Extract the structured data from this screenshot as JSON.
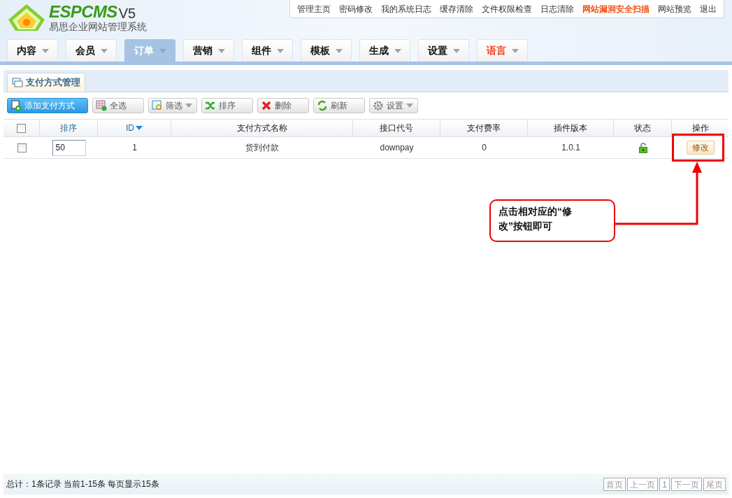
{
  "logo": {
    "brand": "ESPCMS",
    "version": "V5",
    "subtitle": "易思企业网站管理系统"
  },
  "top_links": [
    {
      "label": "管理主页",
      "kind": "normal"
    },
    {
      "label": "密码修改",
      "kind": "normal"
    },
    {
      "label": "我的系统日志",
      "kind": "normal"
    },
    {
      "label": "缓存清除",
      "kind": "normal"
    },
    {
      "label": "文件权限检查",
      "kind": "normal"
    },
    {
      "label": "日志清除",
      "kind": "normal"
    },
    {
      "label": "网站漏洞安全扫描",
      "kind": "alert"
    },
    {
      "label": "网站预览",
      "kind": "normal"
    },
    {
      "label": "退出",
      "kind": "normal"
    }
  ],
  "nav_tabs": [
    {
      "label": "内容",
      "selected": false,
      "kind": "normal"
    },
    {
      "label": "会员",
      "selected": false,
      "kind": "normal"
    },
    {
      "label": "订单",
      "selected": true,
      "kind": "normal"
    },
    {
      "label": "营销",
      "selected": false,
      "kind": "normal"
    },
    {
      "label": "组件",
      "selected": false,
      "kind": "normal"
    },
    {
      "label": "模板",
      "selected": false,
      "kind": "normal"
    },
    {
      "label": "生成",
      "selected": false,
      "kind": "normal"
    },
    {
      "label": "设置",
      "selected": false,
      "kind": "normal"
    },
    {
      "label": "语言",
      "selected": false,
      "kind": "alert"
    }
  ],
  "panel_tab": "支付方式管理",
  "toolbar": [
    {
      "label": "添加支付方式",
      "kind": "primary",
      "dropdown": false
    },
    {
      "label": "全选",
      "kind": "normal",
      "dropdown": false
    },
    {
      "label": "筛选",
      "kind": "normal",
      "dropdown": true
    },
    {
      "label": "排序",
      "kind": "normal",
      "dropdown": false
    },
    {
      "label": "删除",
      "kind": "normal",
      "dropdown": false
    },
    {
      "label": "刷新",
      "kind": "normal",
      "dropdown": false
    },
    {
      "label": "设置",
      "kind": "normal",
      "dropdown": true
    }
  ],
  "table": {
    "header_checkbox_checked": false,
    "columns": [
      "排序",
      "ID",
      "支付方式名称",
      "接口代号",
      "支付费率",
      "插件版本",
      "状态",
      "操作"
    ],
    "rows": [
      {
        "checked": false,
        "sort": "50",
        "id": "1",
        "name": "货到付款",
        "code": "downpay",
        "rate": "0",
        "version": "1.0.1",
        "enabled": true,
        "action": "修改"
      }
    ]
  },
  "annotation": "点击相对应的“修改”按钮即可",
  "footer": {
    "summary": "总计：1条记录 当前1-15条 每页显示15条",
    "pages": [
      "首页",
      "上一页",
      "1",
      "下一页",
      "尾页"
    ]
  }
}
